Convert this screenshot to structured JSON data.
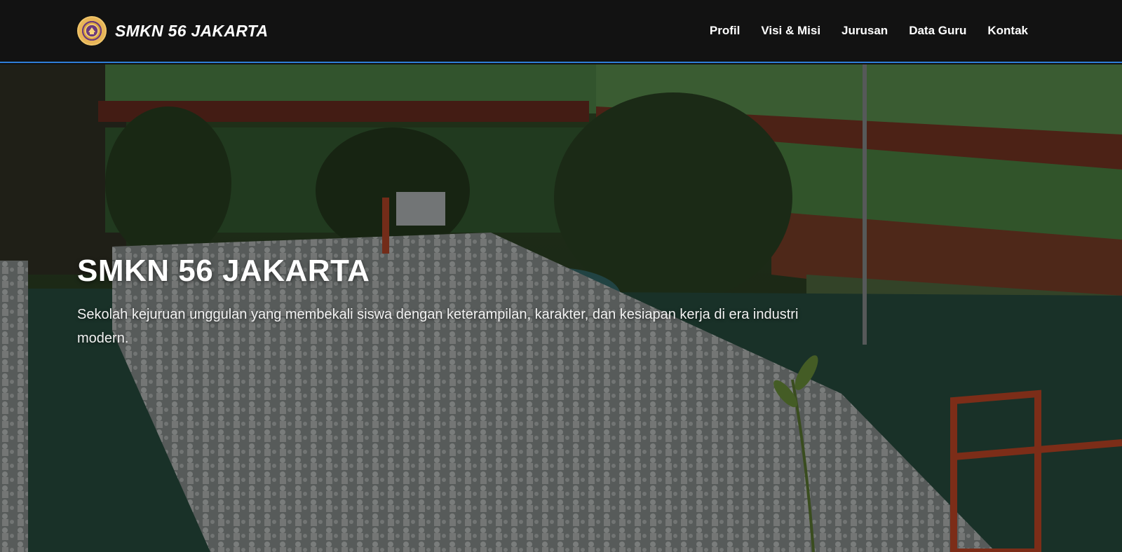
{
  "brand": {
    "name": "SMKN 56 JAKARTA"
  },
  "nav": {
    "items": [
      {
        "label": "Profil"
      },
      {
        "label": "Visi & Misi"
      },
      {
        "label": "Jurusan"
      },
      {
        "label": "Data Guru"
      },
      {
        "label": "Kontak"
      }
    ]
  },
  "hero": {
    "title": "SMKN 56 JAKARTA",
    "subtitle": "Sekolah kejuruan unggulan yang membekali siswa dengan keterampilan, karakter, dan kesiapan kerja di era industri modern."
  },
  "colors": {
    "navbar_bg": "#121212",
    "navbar_border": "#2f7fd8",
    "text": "#ffffff"
  },
  "icons": {
    "logo": "school-emblem-icon"
  }
}
